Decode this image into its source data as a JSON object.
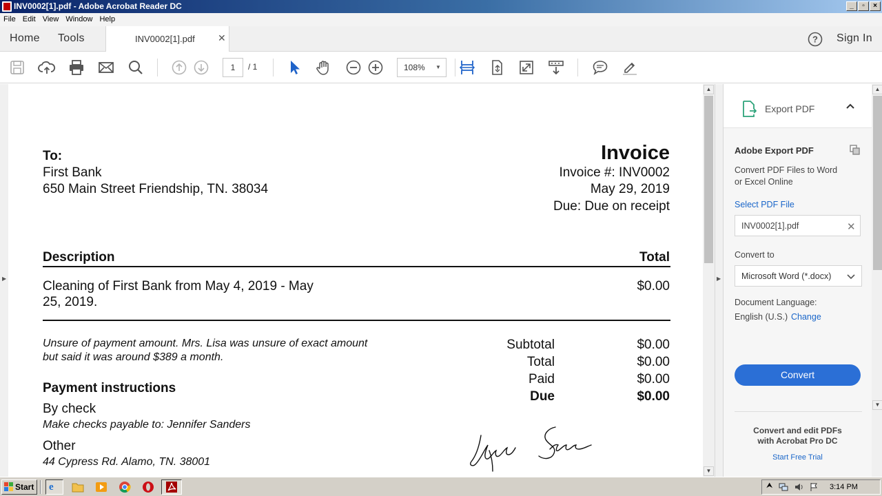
{
  "window": {
    "title": "INV0002[1].pdf - Adobe Acrobat Reader DC"
  },
  "menu": [
    "File",
    "Edit",
    "View",
    "Window",
    "Help"
  ],
  "tabs": {
    "home": "Home",
    "tools": "Tools",
    "document": "INV0002[1].pdf",
    "sign_in": "Sign In"
  },
  "toolbar": {
    "page_current": "1",
    "page_total": "/ 1",
    "zoom": "108%"
  },
  "invoice": {
    "to_label": "To:",
    "to_name": "First Bank",
    "to_address": "650 Main Street Friendship, TN. 38034",
    "title": "Invoice",
    "number": "Invoice #: INV0002",
    "date": "May 29, 2019",
    "due": "Due: Due on receipt",
    "col_description": "Description",
    "col_total": "Total",
    "item_desc_line1": "Cleaning of First Bank from May 4, 2019 - May",
    "item_desc_line2": "25, 2019.",
    "item_total": "$0.00",
    "note_line1": "Unsure of payment amount. Mrs. Lisa was unsure of exact amount",
    "note_line2": "but said it was around $389 a month.",
    "summary": [
      {
        "label": "Subtotal",
        "value": "$0.00"
      },
      {
        "label": "Total",
        "value": "$0.00"
      },
      {
        "label": "Paid",
        "value": "$0.00"
      },
      {
        "label": "Due",
        "value": "$0.00"
      }
    ],
    "payment_heading": "Payment instructions",
    "by_check": "By check",
    "check_note": "Make checks payable to: Jennifer Sanders",
    "other": "Other",
    "other_address": "44 Cypress Rd. Alamo, TN. 38001"
  },
  "export_panel": {
    "header": "Export PDF",
    "title": "Adobe Export PDF",
    "desc_line1": "Convert PDF Files to Word",
    "desc_line2": "or Excel Online",
    "select_label": "Select PDF File",
    "file_name": "INV0002[1].pdf",
    "convert_to_label": "Convert to",
    "format": "Microsoft Word (*.docx)",
    "lang_label": "Document Language:",
    "lang_value": "English (U.S.)",
    "change": "Change",
    "convert_button": "Convert",
    "promo_line1": "Convert and edit PDFs",
    "promo_line2": "with Acrobat Pro DC",
    "trial": "Start Free Trial"
  },
  "taskbar": {
    "start": "Start",
    "clock": "3:14 PM"
  },
  "colors": {
    "accent": "#2b6fd6",
    "link": "#1a66c9",
    "titlebar": "#0a246a",
    "acrobat_red": "#a40000"
  }
}
